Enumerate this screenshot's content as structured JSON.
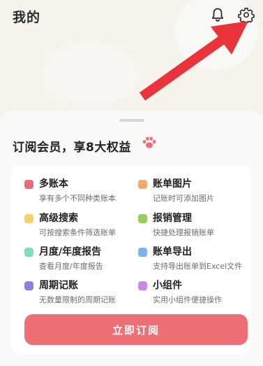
{
  "header": {
    "title": "我的",
    "icons": [
      "bell-icon",
      "gear-icon"
    ]
  },
  "sheet": {
    "title": "订阅会员，享8大权益",
    "title_icon": "paw-icon",
    "benefits": [
      {
        "title": "多账本",
        "desc": "享有多个不同种类账本",
        "color": "#ec6b7a"
      },
      {
        "title": "账单图片",
        "desc": "记账时可添加图片",
        "color": "#f2a96b"
      },
      {
        "title": "高级搜索",
        "desc": "可按搜索条件筛选账单",
        "color": "#f4d36a"
      },
      {
        "title": "报销管理",
        "desc": "快捷处理报销账单",
        "color": "#9ccc5f"
      },
      {
        "title": "月度/年度报告",
        "desc": "查看月度/年度报告",
        "color": "#7fe0b8"
      },
      {
        "title": "账单导出",
        "desc": "支持导出账单到Excel文件",
        "color": "#7fb2f0"
      },
      {
        "title": "周期记账",
        "desc": "无数量限制的周期记账",
        "color": "#8f7ee8"
      },
      {
        "title": "小组件",
        "desc": "实用小组件便捷操作",
        "color": "#c78be6"
      }
    ],
    "cta_label": "立即订阅"
  },
  "colors": {
    "accent": "#ef6f77",
    "arrow": "#e8343a",
    "background": "#f6f2ec"
  }
}
